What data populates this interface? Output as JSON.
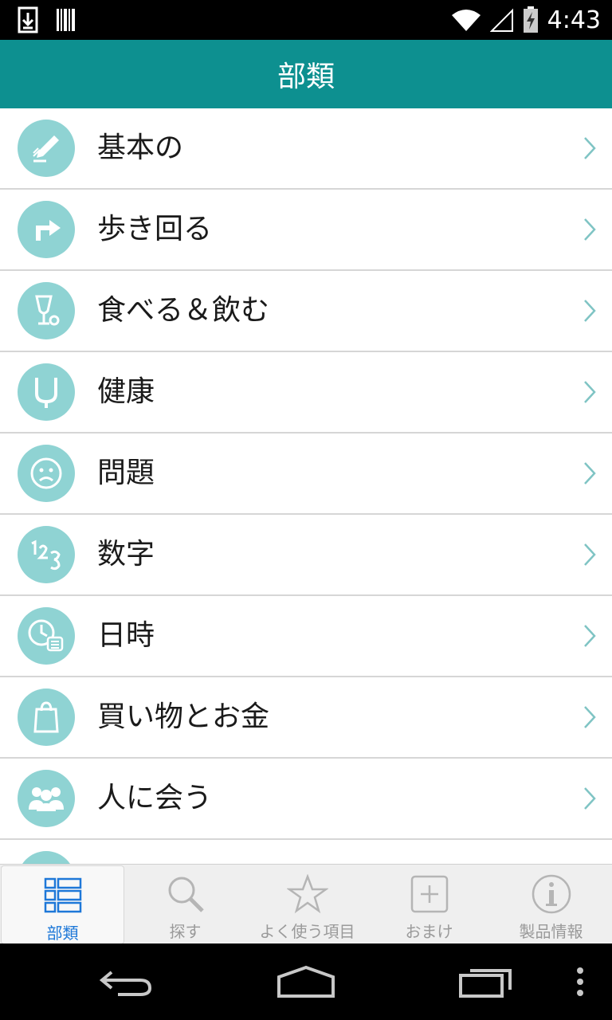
{
  "status_bar": {
    "time": "4:43",
    "icons": [
      "download-icon",
      "barcode-icon",
      "wifi-icon",
      "signal-icon",
      "battery-charging-icon"
    ]
  },
  "header": {
    "title": "部類"
  },
  "categories": [
    {
      "label": "基本の",
      "icon": "pencil-icon"
    },
    {
      "label": "歩き回る",
      "icon": "turn-arrow-icon"
    },
    {
      "label": "食べる＆飲む",
      "icon": "food-drink-icon"
    },
    {
      "label": "健康",
      "icon": "stethoscope-icon"
    },
    {
      "label": "問題",
      "icon": "sad-face-icon"
    },
    {
      "label": "数字",
      "icon": "numbers-icon"
    },
    {
      "label": "日時",
      "icon": "clock-calendar-icon"
    },
    {
      "label": "買い物とお金",
      "icon": "shopping-bag-icon"
    },
    {
      "label": "人に会う",
      "icon": "people-icon"
    }
  ],
  "tabs": [
    {
      "label": "部類",
      "icon": "list-icon",
      "active": true
    },
    {
      "label": "探す",
      "icon": "search-icon",
      "active": false
    },
    {
      "label": "よく使う項目",
      "icon": "star-icon",
      "active": false
    },
    {
      "label": "おまけ",
      "icon": "plus-box-icon",
      "active": false
    },
    {
      "label": "製品情報",
      "icon": "info-icon",
      "active": false
    }
  ],
  "nav_bar": {
    "icons": [
      "back-icon",
      "home-icon",
      "recents-icon",
      "overflow-menu-icon"
    ]
  },
  "colors": {
    "accent": "#0d9090",
    "icon_circle": "#8fd3d3",
    "tab_active": "#1e78d8",
    "chevron": "#7fc4c4"
  }
}
